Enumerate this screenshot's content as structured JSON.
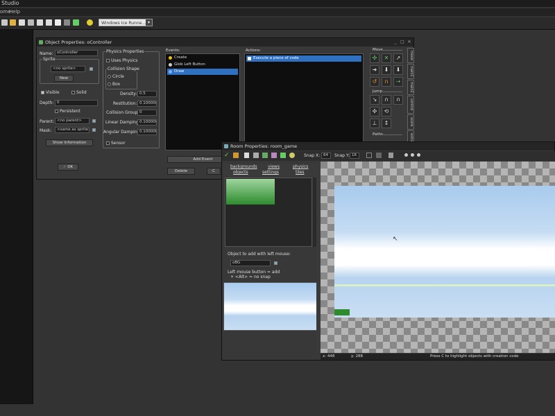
{
  "app": {
    "title_fragment": "Studio",
    "menu": [
      "ome",
      "Help"
    ],
    "toolbar_target": "Windows Ice Runne..."
  },
  "object_window": {
    "title": "Object Properties: oController",
    "name_label": "Name:",
    "name_value": "oController",
    "sprite_group": "Sprite",
    "sprite_value": "<no sprite>",
    "new_button": "New",
    "visible_label": "Visible",
    "solid_label": "Solid",
    "depth_label": "Depth:",
    "depth_value": "0",
    "persistent_label": "Persistent",
    "parent_label": "Parent:",
    "parent_value": "<no parent>",
    "mask_label": "Mask:",
    "mask_value": "<same as sprite>",
    "show_information": "Show Information",
    "ok_button": "OK",
    "physics_group": "Physics Properties",
    "uses_physics": "Uses Physics",
    "collision_shape_group": "Collision Shape",
    "shape_circle": "Circle",
    "shape_box": "Box",
    "density_label": "Density:",
    "density_value": "0.5",
    "restitution_label": "Restitution:",
    "restitution_value": "0.1000000",
    "collision_group_label": "Collision Group:",
    "collision_group_value": "0",
    "linear_damping_label": "Linear Damping:",
    "linear_damping_value": "0.1000000",
    "angular_damping_label": "Angular Damping:",
    "angular_damping_value": "0.1000000",
    "sensor_label": "Sensor",
    "events_header": "Events:",
    "events": [
      {
        "label": "Create",
        "color": "#f2c200"
      },
      {
        "label": "Glob Left Button",
        "color": "#cccccc"
      },
      {
        "label": "Draw",
        "color": "#7fb0ff"
      }
    ],
    "add_event": "Add Event",
    "delete_button": "Delete",
    "change_button": "C",
    "actions_header": "Actions:",
    "actions": [
      "Execute a piece of code"
    ],
    "move_header": "Move",
    "jump_header": "Jump",
    "paths_header": "Paths",
    "side_tabs": [
      "move",
      "main1",
      "main2",
      "control",
      "score",
      "extra"
    ]
  },
  "room_window": {
    "title": "Room Properties: room_game",
    "snap_x_label": "Snap X:",
    "snap_x_value": "64",
    "snap_y_label": "Snap Y:",
    "snap_y_value": "16",
    "tabs_row1": [
      "backgrounds",
      "views",
      "physics"
    ],
    "tabs_row2": [
      "objects",
      "settings",
      "tiles"
    ],
    "object_to_add_label": "Object to add with left mouse:",
    "object_selected": "oBG",
    "help_line1": "Left mouse button = add",
    "help_line2": "+ <Alt> = no snap",
    "status_x": "x: 448",
    "status_y": "y: 288",
    "status_hint": "Press C to highlight objects with creation code"
  },
  "colors": {
    "selection": "#3070c0",
    "window_bg": "#383838",
    "sky": "#a9cbee",
    "grass": "#2e8b2e"
  }
}
